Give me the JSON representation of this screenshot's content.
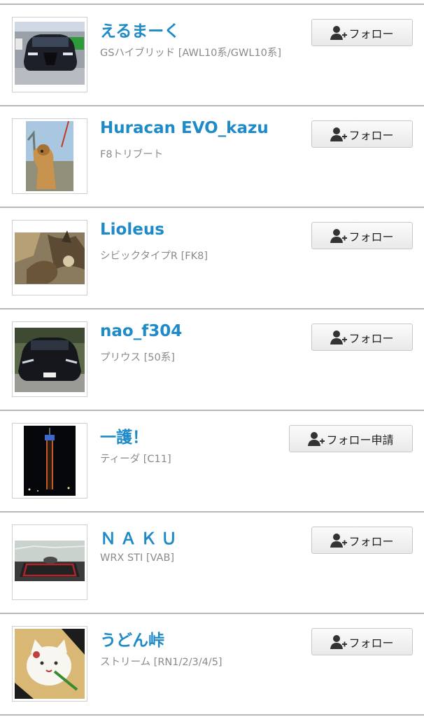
{
  "users": [
    {
      "name": "えるまーく",
      "car": "GSハイブリッド [AWL10系/GWL10系]",
      "button_label": "フォロー",
      "button_type": "follow",
      "thumb": "lexus-car-photo"
    },
    {
      "name": "Huracan EVO_kazu",
      "car": "F8トリブート",
      "button_label": "フォロー",
      "button_type": "follow",
      "thumb": "dog-photo"
    },
    {
      "name": "Lioleus",
      "car": "シビックタイプR [FK8]",
      "button_label": "フォロー",
      "button_type": "follow",
      "thumb": "monster-art"
    },
    {
      "name": "nao_f304",
      "car": "プリウス [50系]",
      "button_label": "フォロー",
      "button_type": "follow",
      "thumb": "prius-car-photo"
    },
    {
      "name": "一護！",
      "car": "ティーダ [C11]",
      "button_label": "フォロー申請",
      "button_type": "request",
      "thumb": "night-tower-photo"
    },
    {
      "name": "ＮＡＫＵ",
      "car": "WRX STI [VAB]",
      "button_label": "フォロー",
      "button_type": "follow",
      "thumb": "dashboard-photo"
    },
    {
      "name": "うどん峠",
      "car": "ストリーム [RN1/2/3/4/5]",
      "button_label": "フォロー",
      "button_type": "follow",
      "thumb": "cat-illustration"
    }
  ],
  "icons": {
    "follow_icon": "add-user-icon"
  },
  "colors": {
    "name_link": "#1e8ac8",
    "subtext": "#8a8a8a",
    "divider": "#b8b8b8"
  }
}
